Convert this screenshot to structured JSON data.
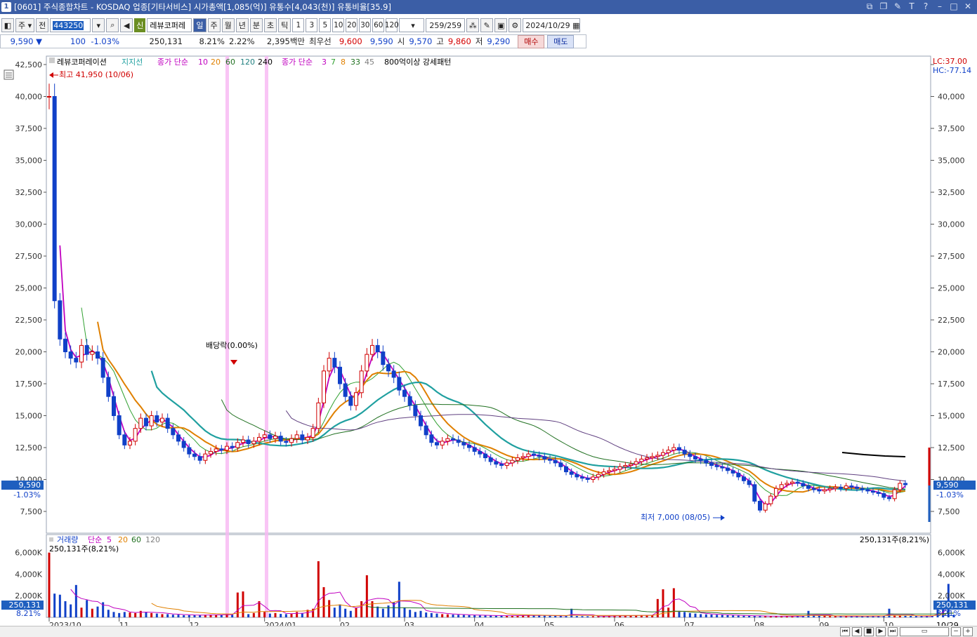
{
  "window": {
    "number": "1",
    "title": "[0601] 주식종합차트 - KOSDAQ 업종[기타서비스] 시가총액[1,085(억)] 유통수[4,043(천)] 유통비율[35.9]"
  },
  "toolbar": {
    "market": "주",
    "all_label": "전",
    "code": "443250",
    "badge": "신",
    "name": "레뷰코퍼레",
    "periods": [
      "일",
      "주",
      "월",
      "년",
      "분",
      "초",
      "틱"
    ],
    "selected_period": "일",
    "minutes": [
      "1",
      "3",
      "5",
      "10",
      "20",
      "30",
      "60",
      "120"
    ],
    "count": "259/259",
    "date": "2024/10/29"
  },
  "quote": {
    "price": "9,590 ▼",
    "change": "100",
    "change_pct": "-1.03%",
    "volume": "250,131",
    "turnover": "8.21%",
    "ratio": "2.22%",
    "amount": "2,395백만",
    "best_label": "최우선",
    "best_ask": "9,600",
    "best_bid": "9,590",
    "open_label": "시",
    "open": "9,570",
    "high_label": "고",
    "high": "9,860",
    "low_label": "저",
    "low": "9,290",
    "buy_button": "매수",
    "sell_button": "매도"
  },
  "chart_data": {
    "type": "candlestick",
    "legend": {
      "name": "레뷰코퍼레이션",
      "support": "지지선",
      "ma_label": "종가 단순",
      "ma_periods": [
        "10",
        "20",
        "60",
        "120",
        "240"
      ],
      "ma2_label": "종가 단순",
      "ma2_periods": [
        "3",
        "7",
        "8",
        "33",
        "45"
      ],
      "pattern": "800억이상 강세패턴"
    },
    "top_right": {
      "lc": "LC:37.00",
      "hc": "HC:-77.14"
    },
    "y_axis": {
      "ticks": [
        "42,500",
        "40,000",
        "37,500",
        "35,000",
        "32,500",
        "30,000",
        "27,500",
        "25,000",
        "22,500",
        "20,000",
        "17,500",
        "15,000",
        "12,500",
        "10,000",
        "7,500"
      ],
      "ylim": [
        6500,
        42500
      ]
    },
    "price_label": "9,590",
    "price_pct": "-1.03%",
    "high_annotation": "최고 41,950 (10/06)",
    "low_annotation": "최저 7,000 (08/05)",
    "dividend_annotation": "배당락(0.00%)",
    "x_ticks": [
      "2023/10",
      "11",
      "12",
      "2024/01",
      "02",
      "03",
      "04",
      "05",
      "06",
      "07",
      "08",
      "09",
      "10"
    ],
    "x_last": "10/29",
    "closes": [
      40000,
      24000,
      21000,
      20000,
      19500,
      19200,
      20500,
      19800,
      20000,
      19500,
      18000,
      16500,
      15000,
      13500,
      12700,
      13000,
      14000,
      14800,
      14200,
      15000,
      14500,
      14800,
      14000,
      13500,
      13000,
      12500,
      12000,
      11800,
      11500,
      12000,
      12200,
      12400,
      12300,
      12600,
      12500,
      12900,
      13100,
      12800,
      13000,
      13300,
      13500,
      13200,
      13400,
      13000,
      12900,
      13200,
      13500,
      13100,
      13300,
      14000,
      16000,
      18500,
      19500,
      18800,
      17500,
      16500,
      15800,
      16800,
      18500,
      19800,
      20500,
      20000,
      19000,
      18500,
      18000,
      17000,
      16500,
      15800,
      15000,
      14200,
      13500,
      12900,
      12700,
      13000,
      13200,
      13100,
      12900,
      12700,
      12500,
      12200,
      12000,
      11700,
      11400,
      11200,
      11100,
      11300,
      11500,
      11700,
      11800,
      12000,
      11900,
      11800,
      11600,
      11500,
      11300,
      11000,
      10600,
      10400,
      10200,
      10100,
      10000,
      10200,
      10400,
      10600,
      10700,
      10800,
      11000,
      11100,
      11200,
      11400,
      11600,
      11700,
      11800,
      11900,
      12100,
      12300,
      12500,
      12300,
      12000,
      11800,
      11600,
      11500,
      11300,
      11100,
      11000,
      10900,
      10700,
      10500,
      10200,
      9900,
      9600,
      8300,
      7600,
      8100,
      8700,
      9300,
      9600,
      9700,
      9800,
      9700,
      9500,
      9300,
      9200,
      9100,
      9200,
      9300,
      9400,
      9300,
      9500,
      9400,
      9300,
      9200,
      9100,
      9000,
      8900,
      8600,
      8500,
      9200,
      9700,
      9590
    ],
    "volume_label": "거래량",
    "volume_ma_label": "단순",
    "volume_ma_periods": [
      "5",
      "20",
      "60",
      "120"
    ],
    "volume_info": "250,131주(8,21%)",
    "volume_ticks": [
      "6,000K",
      "4,000K",
      "2,000K"
    ],
    "volume_current": "250,131",
    "volume_pct": "8.21%",
    "volumes_k": [
      6000,
      2200,
      2100,
      1500,
      1200,
      3000,
      900,
      1600,
      800,
      1000,
      1400,
      700,
      500,
      400,
      500,
      450,
      400,
      600,
      500,
      400,
      350,
      300,
      300,
      250,
      250,
      200,
      200,
      220,
      200,
      240,
      260,
      230,
      210,
      280,
      250,
      2300,
      2400,
      300,
      400,
      1500,
      500,
      350,
      400,
      320,
      300,
      350,
      500,
      400,
      700,
      800,
      5200,
      2800,
      1600,
      900,
      1200,
      800,
      600,
      900,
      1500,
      3900,
      1500,
      1000,
      800,
      1100,
      1400,
      3300,
      900,
      700,
      500,
      600,
      450,
      400,
      350,
      300,
      280,
      260,
      240,
      220,
      200,
      190,
      180,
      170,
      160,
      150,
      150,
      160,
      170,
      180,
      190,
      200,
      180,
      170,
      160,
      150,
      140,
      130,
      120,
      800,
      120,
      110,
      100,
      110,
      120,
      130,
      140,
      150,
      160,
      170,
      180,
      190,
      200,
      210,
      220,
      1700,
      2600,
      900,
      2700,
      600,
      500,
      400,
      350,
      300,
      280,
      260,
      240,
      220,
      200,
      180,
      160,
      150,
      140,
      130,
      120,
      110,
      100,
      100,
      100,
      110,
      120,
      130,
      140,
      600,
      150,
      140,
      130,
      120,
      110,
      100,
      100,
      100,
      100,
      110,
      120,
      130,
      140,
      150,
      800,
      160,
      150,
      140,
      130,
      120,
      110,
      100,
      110,
      1000,
      900,
      3100,
      250
    ]
  }
}
